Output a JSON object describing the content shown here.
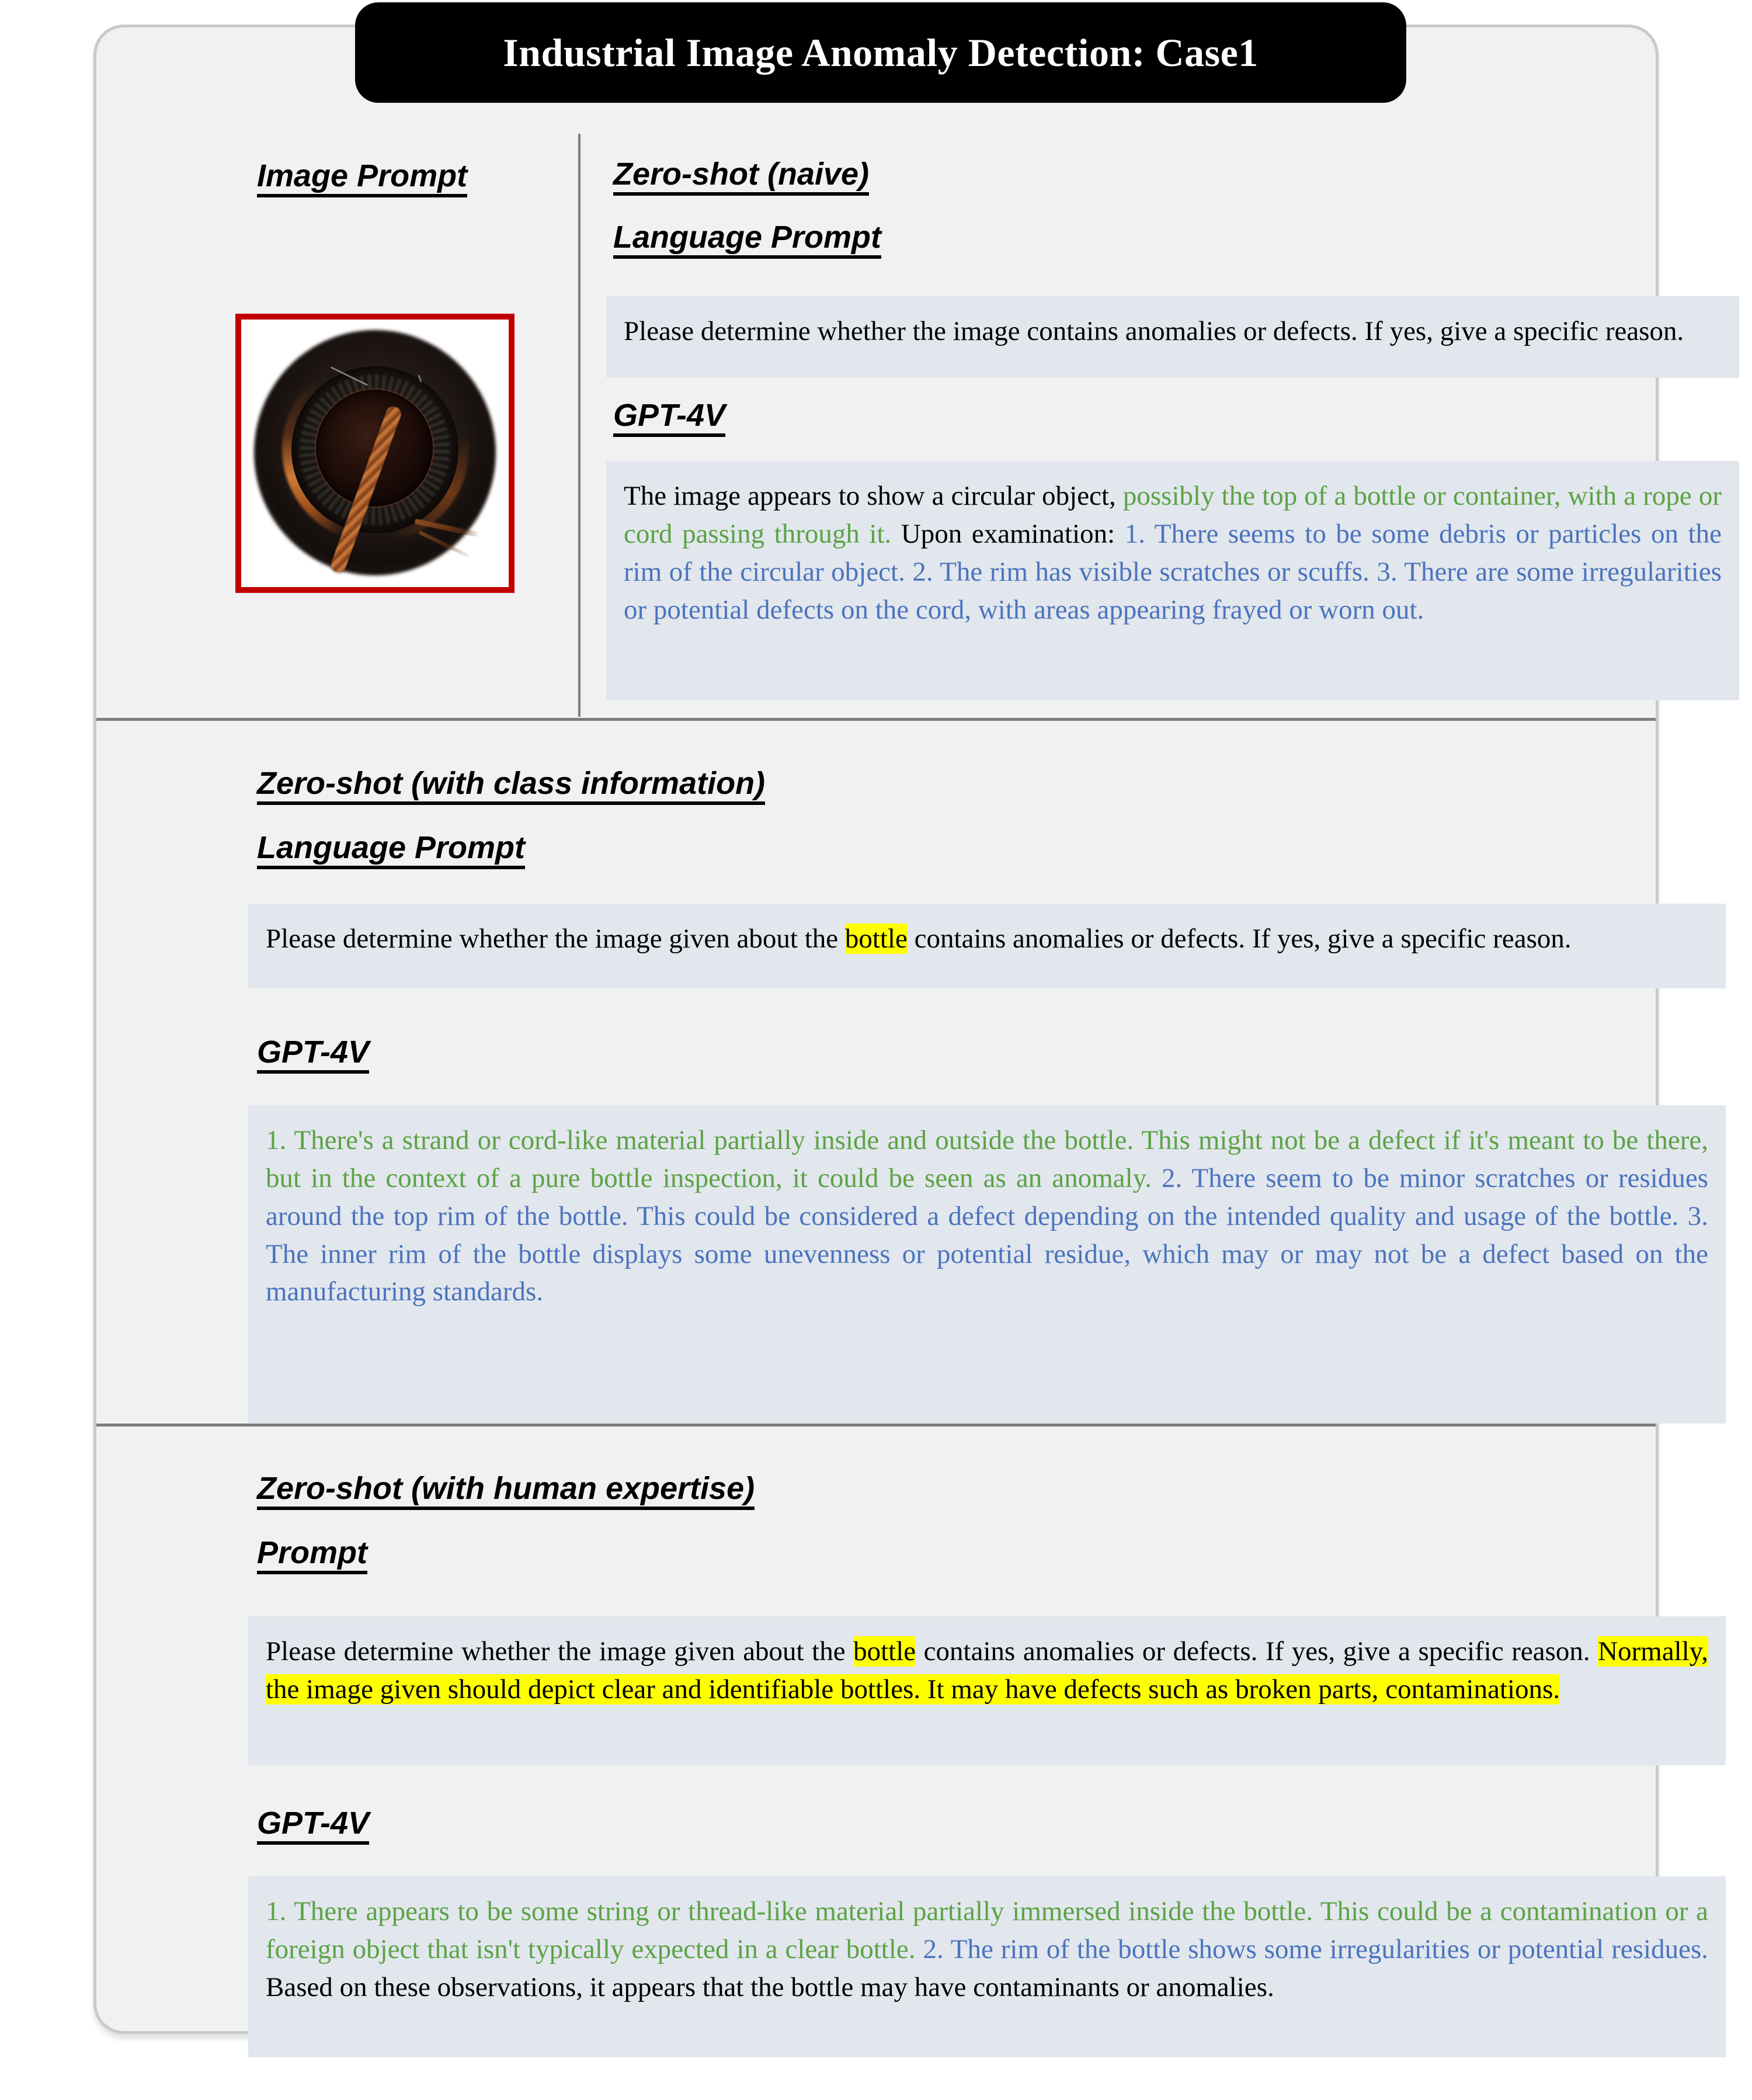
{
  "title": "Industrial Image Anomaly Detection: Case1",
  "section1": {
    "image_prompt_label": "Image Prompt",
    "image_caption": "bottle-top-with-cord-photo",
    "setting_label": "Zero-shot (naive)",
    "language_prompt_label": "Language Prompt",
    "language_prompt_text": "Please determine whether the image contains anomalies or defects. If yes, give a specific reason.",
    "model_label": "GPT-4V",
    "response": {
      "part1_black": "The image appears to show a circular object,",
      "part2_green": " possibly the top of a bottle or container, with a rope or cord passing through it.",
      "part3_black": " Upon examination:",
      "part4_blue": " 1. There seems to be some debris or particles on the rim of the circular object. 2. The rim has visible scratches or scuffs. 3. There are some irregularities or potential defects on the cord, with areas appearing frayed or worn out."
    }
  },
  "section2": {
    "setting_label": "Zero-shot (with class information)",
    "language_prompt_label": "Language Prompt",
    "prompt": {
      "part1": "Please determine whether the image given about the ",
      "highlight1": "bottle",
      "part2": " contains anomalies or defects. If yes, give a specific reason."
    },
    "model_label": "GPT-4V",
    "response": {
      "part1_green": "1. There's a strand or cord-like material partially inside and outside the bottle. This might not be a defect if it's meant to be there, but in the context of a pure bottle inspection, it could be seen as an anomaly.",
      "part2_blue": " 2. There seem to be minor scratches or residues around the top rim of the bottle. This could be considered a defect depending on the intended quality and usage of the bottle. 3. The inner rim of the bottle displays some unevenness or potential residue, which may or may not be a defect based on the manufacturing standards."
    }
  },
  "section3": {
    "setting_label": "Zero-shot (with human expertise)",
    "prompt_label": "Prompt",
    "prompt": {
      "part1": "Please determine whether the image given about the ",
      "highlight1": "bottle",
      "part2": " contains anomalies or defects. If yes, give a specific reason. ",
      "highlight2": "Normally, the image given should depict clear and identifiable bottles. It may have defects such as broken parts, contaminations."
    },
    "model_label": "GPT-4V",
    "response": {
      "part1_green": "1. There appears to be some string or thread-like material partially immersed inside the bottle. This could be a contamination or a foreign object that isn't typically expected in a clear bottle.",
      "part2_blue": " 2. The rim of the bottle shows some irregularities or potential residues.",
      "part3_black": " Based on these observations, it appears that the bottle may have contaminants or anomalies."
    }
  },
  "colors": {
    "green": "#5ba345",
    "blue": "#4a74bd",
    "highlight": "#ffff00",
    "box_bg": "#e2e6ed",
    "card_bg": "#f1f1f1",
    "image_border": "#c00000"
  }
}
